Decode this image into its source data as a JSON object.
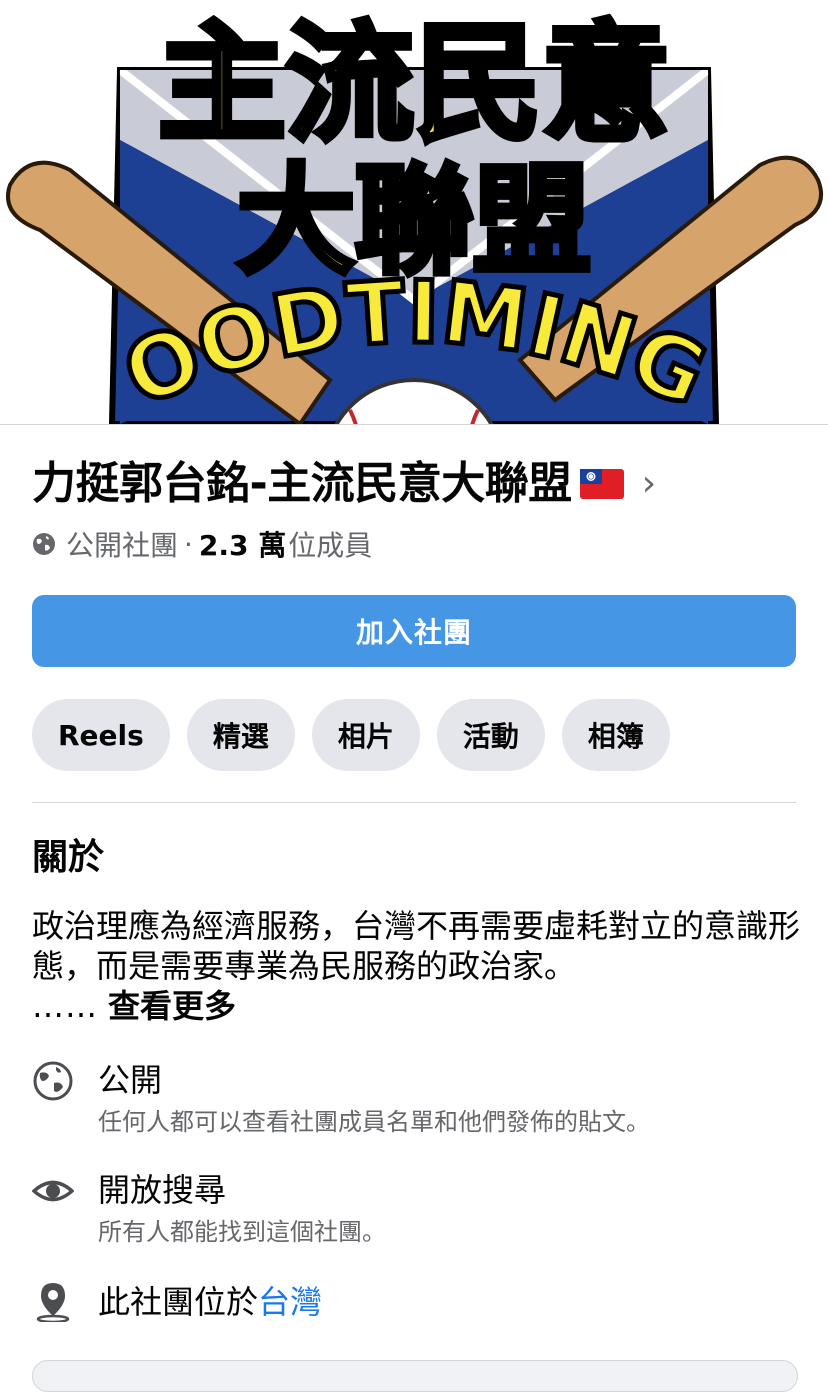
{
  "cover": {
    "logo_line1": "主流民意",
    "logo_line2": "大聯盟",
    "logo_arc": "OODTIMING"
  },
  "group": {
    "name": "力挺郭台銘-主流民意大聯盟",
    "privacy": "公開社團",
    "separator": "·",
    "member_count": "2.3 萬",
    "member_suffix": "位成員"
  },
  "join_button": {
    "label": "加入社團"
  },
  "tabs": [
    {
      "label": "Reels"
    },
    {
      "label": "精選"
    },
    {
      "label": "相片"
    },
    {
      "label": "活動"
    },
    {
      "label": "相簿"
    }
  ],
  "about": {
    "heading": "關於",
    "description": "政治理應為經濟服務，台灣不再需要虛耗對立的意識形態，而是需要專業為民服務的政治家。",
    "ellipsis": "……",
    "see_more": "查看更多",
    "items": [
      {
        "icon": "globe-icon",
        "title": "公開",
        "description": "任何人都可以查看社團成員名單和他們發佈的貼文。"
      },
      {
        "icon": "eye-icon",
        "title": "開放搜尋",
        "description": "所有人都能找到這個社團。"
      },
      {
        "icon": "location-pin-icon",
        "title_prefix": "此社團位於",
        "title_link": "台灣"
      }
    ]
  },
  "colors": {
    "primary_button": "#4597e6",
    "chip_bg": "#e4e6eb",
    "secondary_text": "#65676b",
    "link": "#1877f2",
    "logo_yellow": "#f7ea3a",
    "logo_blue": "#1d3f94"
  }
}
